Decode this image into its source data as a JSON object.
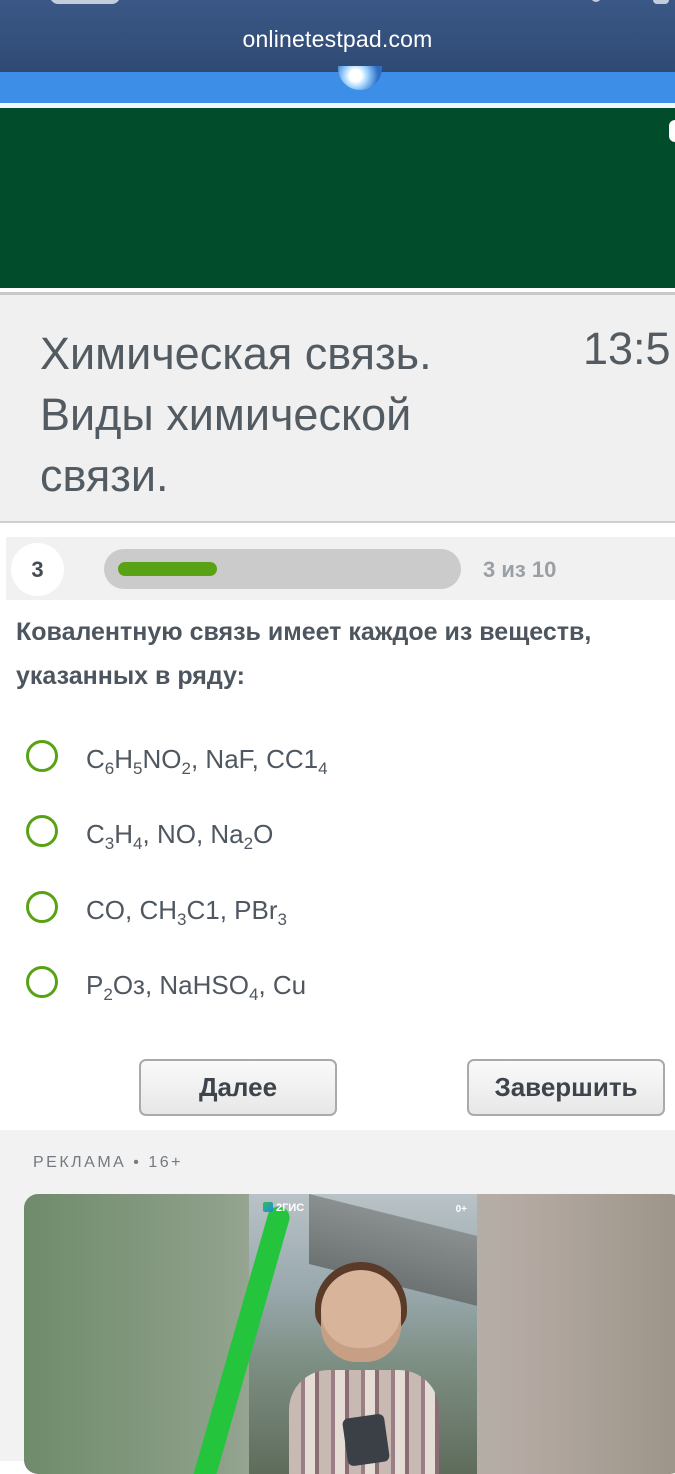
{
  "browser": {
    "url": "onlinetestpad.com"
  },
  "test": {
    "title": "Химическая связь. Виды химической связи.",
    "timer": "13:5"
  },
  "progress": {
    "current_number": "3",
    "count_text": "3 из 10",
    "fraction": 0.3
  },
  "question": {
    "text": "Ковалентную  связь имеет каждое из веществ, указанных в ряду:",
    "options": [
      {
        "parts": [
          [
            "C",
            ""
          ],
          [
            "6",
            "sub"
          ],
          [
            "H",
            ""
          ],
          [
            "5",
            "sub"
          ],
          [
            "NO",
            ""
          ],
          [
            "2",
            "sub"
          ],
          [
            ", NaF, CC1",
            ""
          ],
          [
            "4",
            "sub"
          ]
        ]
      },
      {
        "parts": [
          [
            "C",
            ""
          ],
          [
            "3",
            "sub"
          ],
          [
            "H",
            ""
          ],
          [
            "4",
            "sub"
          ],
          [
            ", NO, Na",
            ""
          ],
          [
            "2",
            "sub"
          ],
          [
            "O",
            ""
          ]
        ]
      },
      {
        "parts": [
          [
            "CO, CH",
            ""
          ],
          [
            "3",
            "sub"
          ],
          [
            "C1, PBr",
            ""
          ],
          [
            "3",
            "sub"
          ]
        ]
      },
      {
        "parts": [
          [
            "P",
            ""
          ],
          [
            "2",
            "sub"
          ],
          [
            "Oз, NaHSO",
            ""
          ],
          [
            "4",
            "sub"
          ],
          [
            ", Cu",
            ""
          ]
        ]
      }
    ]
  },
  "buttons": {
    "next": "Далее",
    "finish": "Завершить"
  },
  "ad": {
    "label": "РЕКЛАМА • 16+",
    "brand": "2ГИС",
    "age": "0+"
  },
  "colors": {
    "accent_green": "#5aa215",
    "banner_green": "#014d2b",
    "site_blue": "#3d8ee6"
  }
}
